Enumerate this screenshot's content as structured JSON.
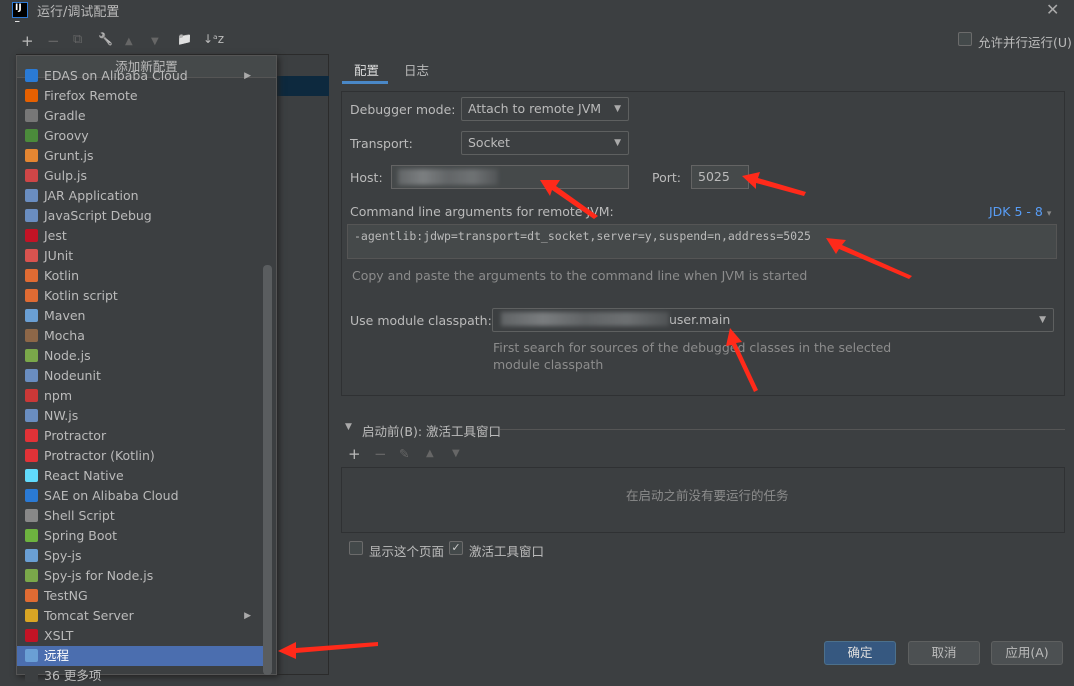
{
  "window": {
    "title": "运行/调试配置",
    "close_icon": "close-icon"
  },
  "toolbar": {
    "add": "+",
    "remove": "−",
    "copy": "⧉",
    "edit": "🔧",
    "up": "▲",
    "down": "▼",
    "folder": "📁",
    "sort": "↓ᵃz"
  },
  "parallel_run": {
    "label": "允许并行运行(U)",
    "checked": false
  },
  "popup": {
    "title": "添加新配置",
    "items": [
      {
        "label": "EDAS on Alibaba Cloud",
        "color": "#2a7ad5",
        "submenu": true
      },
      {
        "label": "Firefox Remote",
        "color": "#e66000"
      },
      {
        "label": "Gradle",
        "color": "#777777"
      },
      {
        "label": "Groovy",
        "color": "#4b8b3b"
      },
      {
        "label": "Grunt.js",
        "color": "#e48632"
      },
      {
        "label": "Gulp.js",
        "color": "#cf4647"
      },
      {
        "label": "JAR Application",
        "color": "#6a8dc0"
      },
      {
        "label": "JavaScript Debug",
        "color": "#6a8dc0"
      },
      {
        "label": "Jest",
        "color": "#c21325"
      },
      {
        "label": "JUnit",
        "color": "#d9534f"
      },
      {
        "label": "Kotlin",
        "color": "#e06b33"
      },
      {
        "label": "Kotlin script",
        "color": "#e06b33"
      },
      {
        "label": "Maven",
        "color": "#6a9fd4"
      },
      {
        "label": "Mocha",
        "color": "#8d6748"
      },
      {
        "label": "Node.js",
        "color": "#7aa84a"
      },
      {
        "label": "Nodeunit",
        "color": "#6a8dc0"
      },
      {
        "label": "npm",
        "color": "#cb3837"
      },
      {
        "label": "NW.js",
        "color": "#6a8dc0"
      },
      {
        "label": "Protractor",
        "color": "#e23237"
      },
      {
        "label": "Protractor (Kotlin)",
        "color": "#e23237"
      },
      {
        "label": "React Native",
        "color": "#61dafb"
      },
      {
        "label": "SAE on Alibaba Cloud",
        "color": "#2a7ad5"
      },
      {
        "label": "Shell Script",
        "color": "#888888"
      },
      {
        "label": "Spring Boot",
        "color": "#6db33f"
      },
      {
        "label": "Spy-js",
        "color": "#6a9fd4"
      },
      {
        "label": "Spy-js for Node.js",
        "color": "#7aa84a"
      },
      {
        "label": "TestNG",
        "color": "#e06b33"
      },
      {
        "label": "Tomcat Server",
        "color": "#d9a524",
        "submenu": true
      },
      {
        "label": "XSLT",
        "color": "#c21325"
      },
      {
        "label": "远程",
        "color": "#6a9fd4",
        "selected": true
      },
      {
        "label": "36 更多项",
        "color": "#3c3f41"
      }
    ]
  },
  "tabs": [
    {
      "label": "配置",
      "active": true
    },
    {
      "label": "日志"
    }
  ],
  "config": {
    "debugger_mode_label": "Debugger mode:",
    "debugger_mode": "Attach to remote JVM",
    "transport_label": "Transport:",
    "transport": "Socket",
    "host_label": "Host:",
    "port_label": "Port:",
    "port": "5025",
    "cmd_label": "Command line arguments for remote JVM:",
    "jdk": "JDK 5 - 8",
    "cmd": "-agentlib:jdwp=transport=dt_socket,server=y,suspend=n,address=5025",
    "cmd_hint": "Copy and paste the arguments to the command line when JVM is started",
    "module_label": "Use module classpath:",
    "module": "user.main",
    "module_hint1": "First search for sources of the debugged classes in the selected",
    "module_hint2": "module classpath"
  },
  "before_launch": {
    "title": "启动前(B): 激活工具窗口",
    "empty": "在启动之前没有要运行的任务"
  },
  "options": {
    "show_page": {
      "label": "显示这个页面",
      "checked": false
    },
    "activate_tool": {
      "label": "激活工具窗口",
      "checked": true
    }
  },
  "buttons": {
    "ok": "确定",
    "cancel": "取消",
    "apply": "应用(A)"
  },
  "colors": {
    "background": "#3c3f41",
    "selection": "#4b6eaf",
    "accent": "#4a88c7",
    "annotation": "#ff2a1a"
  }
}
